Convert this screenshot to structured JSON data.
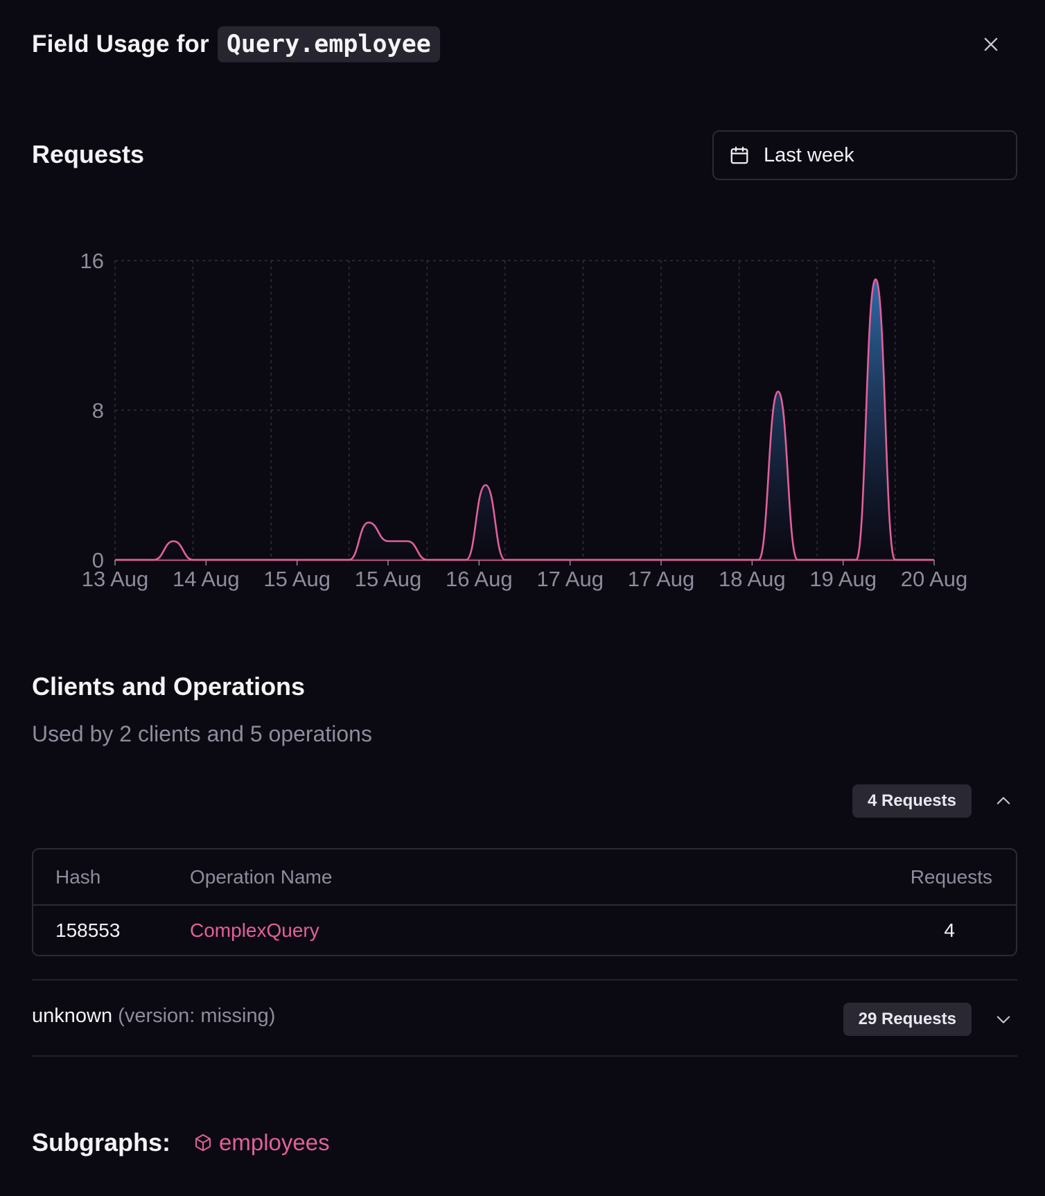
{
  "header": {
    "title": "Field Usage for",
    "field": "Query.employee"
  },
  "requests": {
    "title": "Requests",
    "range_label": "Last week"
  },
  "chart_data": {
    "type": "area",
    "title": "",
    "xlabel": "",
    "ylabel": "",
    "ylim": [
      0,
      16
    ],
    "yticks": [
      "0",
      "8",
      "16"
    ],
    "xticks": [
      "13 Aug",
      "14 Aug",
      "15 Aug",
      "15 Aug",
      "16 Aug",
      "17 Aug",
      "17 Aug",
      "18 Aug",
      "19 Aug",
      "20 Aug"
    ],
    "grid": true,
    "series": [
      {
        "x": [
          0,
          0.5,
          0.75,
          1.0,
          1.5,
          3.0,
          3.25,
          3.5,
          3.75,
          4.0,
          4.25,
          4.5,
          4.75,
          5.0,
          6.0,
          8.25,
          8.5,
          8.75,
          9.0,
          9.5,
          9.75,
          10.0,
          10.5,
          10.5
        ],
        "y": [
          0,
          0,
          1,
          0,
          0,
          0,
          2,
          1,
          1,
          0,
          0,
          0,
          4,
          0,
          0,
          0,
          9,
          0,
          0,
          0,
          15,
          0,
          0,
          0
        ]
      }
    ],
    "colors": {
      "line": "#e2609a",
      "fill_top": "#2f6aa8",
      "fill_bottom": "#0b0912"
    }
  },
  "clients": {
    "title": "Clients and Operations",
    "subtitle": "Used by 2 clients and 5 operations",
    "first": {
      "badge": "4 Requests",
      "table": {
        "headers": [
          "Hash",
          "Operation Name",
          "Requests"
        ],
        "rows": [
          {
            "hash": "158553",
            "name": "ComplexQuery",
            "requests": "4"
          }
        ]
      }
    },
    "second": {
      "name": "unknown",
      "version": "(version: missing)",
      "badge": "29 Requests"
    }
  },
  "subgraphs": {
    "label": "Subgraphs:",
    "items": [
      "employees"
    ]
  }
}
